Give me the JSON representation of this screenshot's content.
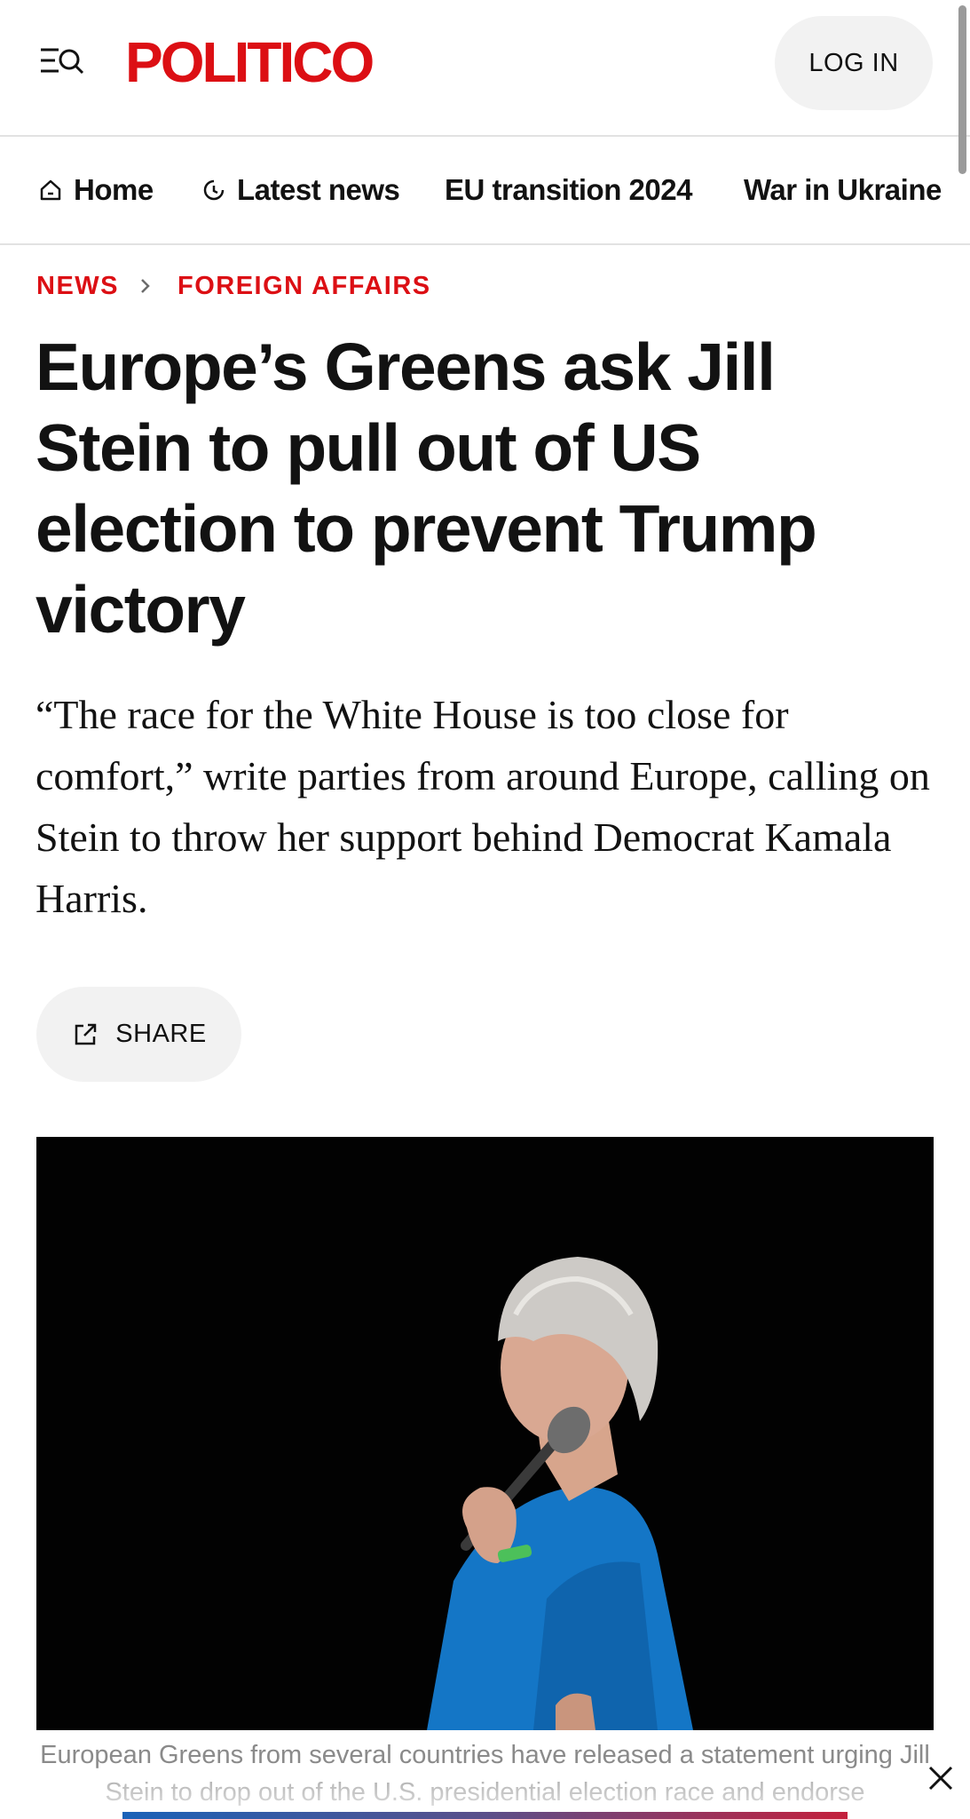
{
  "header": {
    "logo_text": "POLITICO",
    "login_label": "LOG IN",
    "menu_icon": "menu-search-icon"
  },
  "nav": {
    "items": [
      {
        "label": "Home",
        "icon": "home-icon"
      },
      {
        "label": "Latest news",
        "icon": "clock-icon"
      },
      {
        "label": "EU transition 2024"
      },
      {
        "label": "War in Ukraine"
      }
    ]
  },
  "breadcrumb": {
    "section": "NEWS",
    "subsection": "FOREIGN AFFAIRS"
  },
  "article": {
    "headline": "Europe’s Greens ask Jill Stein to pull out of US election to prevent Trump victory",
    "dek": "“The race for the White House is too close for comfort,” write parties from around Europe, calling on Stein to throw her support behind Democrat Kamala Harris.",
    "share_label": "SHARE",
    "caption": "European Greens from several countries have released a statement urging Jill Stein to drop out of the U.S. presidential election race and endorse"
  },
  "colors": {
    "brand_red": "#dc0f14",
    "text": "#121212",
    "pill_bg": "#f2f2f2"
  }
}
